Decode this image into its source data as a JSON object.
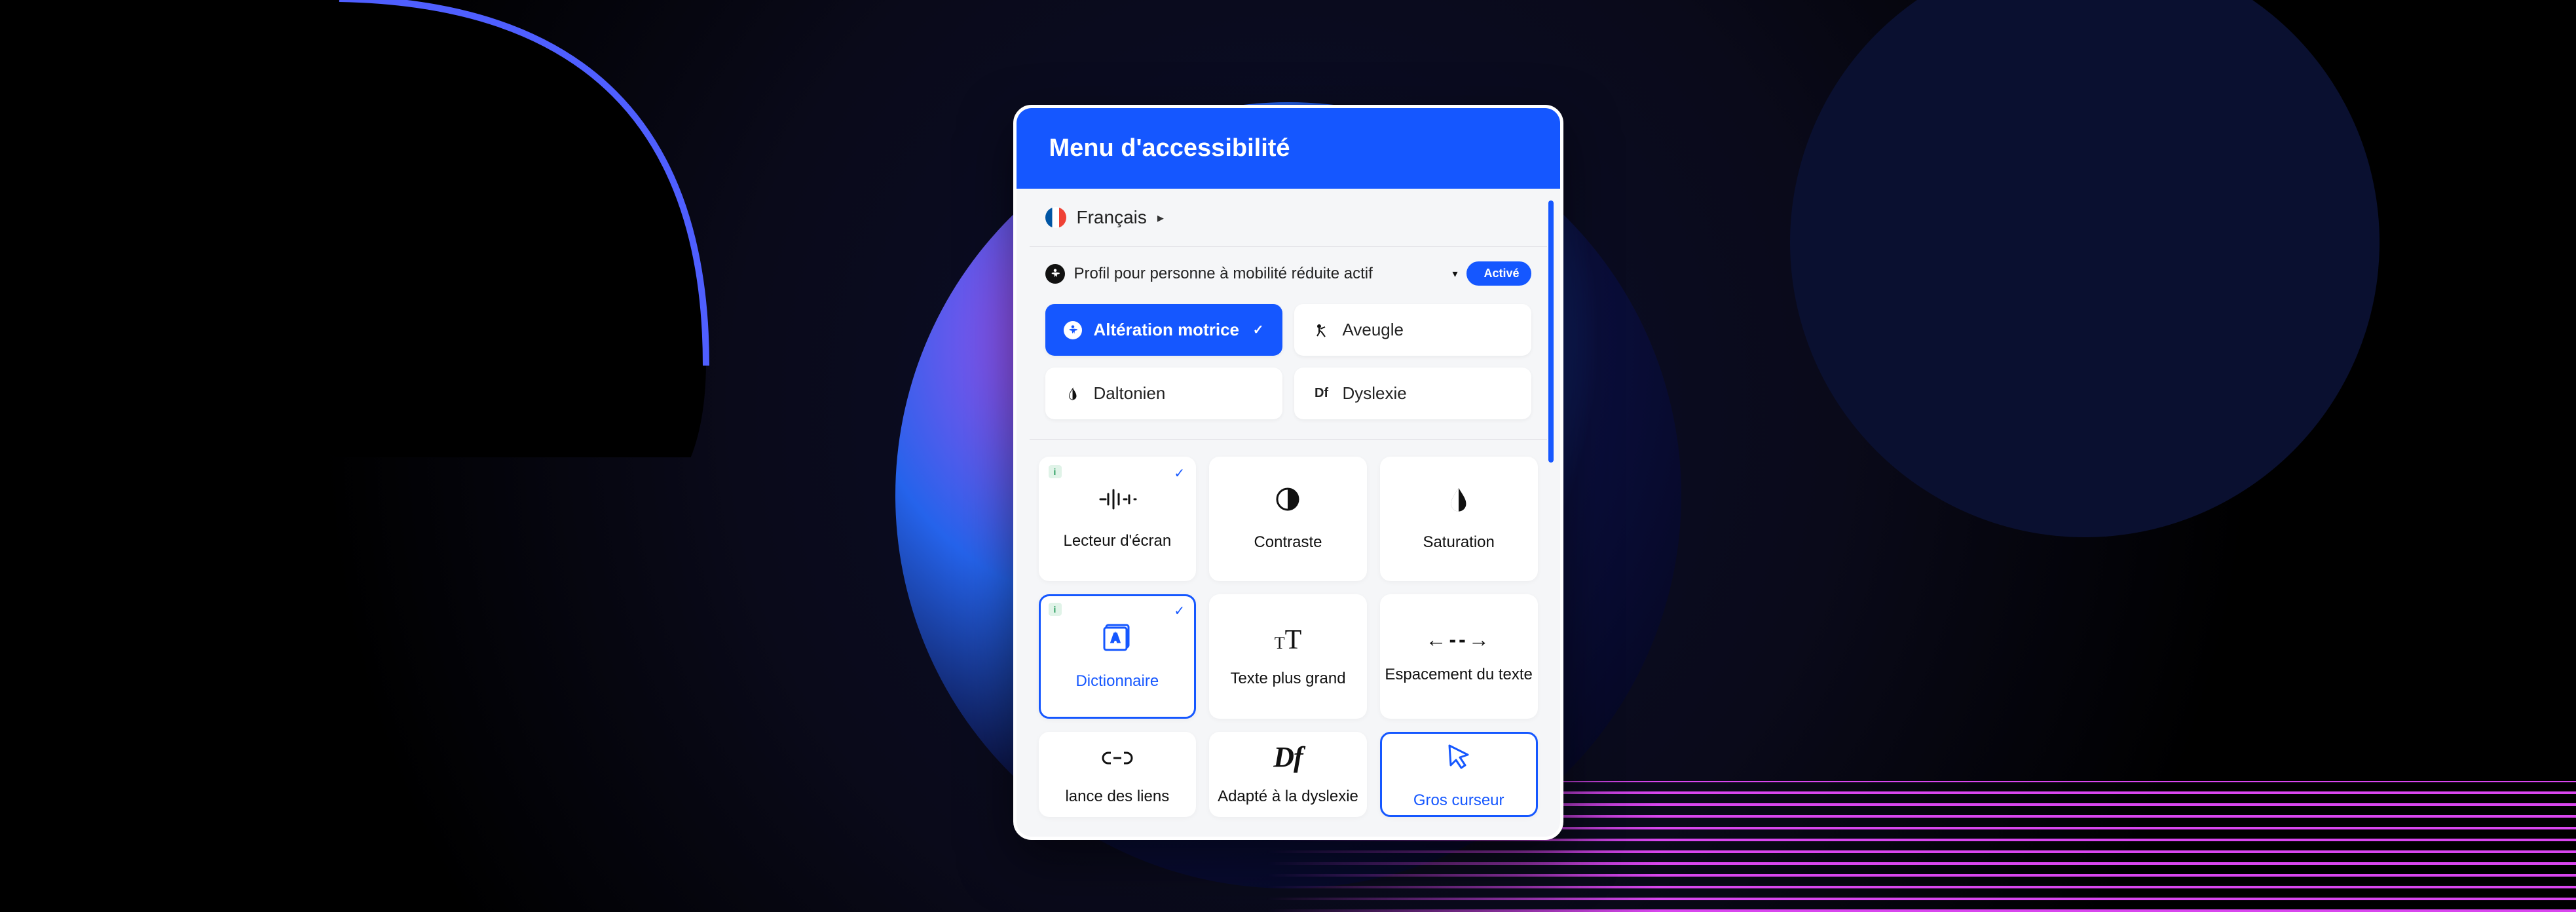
{
  "header": {
    "title": "Menu d'accessibilité"
  },
  "language": {
    "label": "Français"
  },
  "activeProfile": {
    "label": "Profil pour personne à mobilité réduite actif",
    "toggle": "Activé"
  },
  "profiles": [
    {
      "label": "Altération motrice",
      "active": true
    },
    {
      "label": "Aveugle",
      "active": false
    },
    {
      "label": "Daltonien",
      "active": false
    },
    {
      "label": "Dyslexie",
      "active": false
    }
  ],
  "tools": [
    {
      "label": "Lecteur d'écran",
      "info": true,
      "check": true,
      "selected": false
    },
    {
      "label": "Contraste",
      "info": false,
      "check": false,
      "selected": false
    },
    {
      "label": "Saturation",
      "info": false,
      "check": false,
      "selected": false
    },
    {
      "label": "Dictionnaire",
      "info": true,
      "check": true,
      "selected": true
    },
    {
      "label": "Texte plus grand",
      "info": false,
      "check": false,
      "selected": false
    },
    {
      "label": "Espacement du texte",
      "info": false,
      "check": false,
      "selected": false
    },
    {
      "label": "lance des liens",
      "info": false,
      "check": false,
      "selected": false
    },
    {
      "label": "Adapté à la dyslexie",
      "info": false,
      "check": false,
      "selected": false
    },
    {
      "label": "Gros curseur",
      "info": false,
      "check": false,
      "selected": true
    }
  ],
  "icons": {
    "df_small": "Df"
  }
}
